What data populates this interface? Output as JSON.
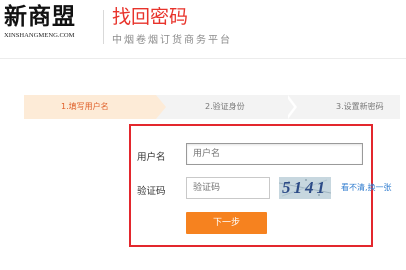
{
  "header": {
    "logo_main": "新商盟",
    "logo_sub": "XINSHANGMENG.COM",
    "title": "找回密码",
    "subtitle": "中烟卷烟订货商务平台"
  },
  "steps": [
    {
      "label": "1.填写用户名",
      "active": true
    },
    {
      "label": "2.验证身份",
      "active": false
    },
    {
      "label": "3.设置新密码",
      "active": false
    }
  ],
  "form": {
    "username_label": "用户名",
    "username_placeholder": "用户名",
    "captcha_label": "验证码",
    "captcha_placeholder": "验证码",
    "captcha_text": "5141",
    "refresh_link_a": "看不清,",
    "refresh_link_b": "换一张",
    "next_button": "下一步"
  },
  "colors": {
    "accent_red": "#e8332b",
    "step_active": "#e0602a",
    "button_orange": "#f6821f",
    "link_blue": "#2e7bcf"
  }
}
